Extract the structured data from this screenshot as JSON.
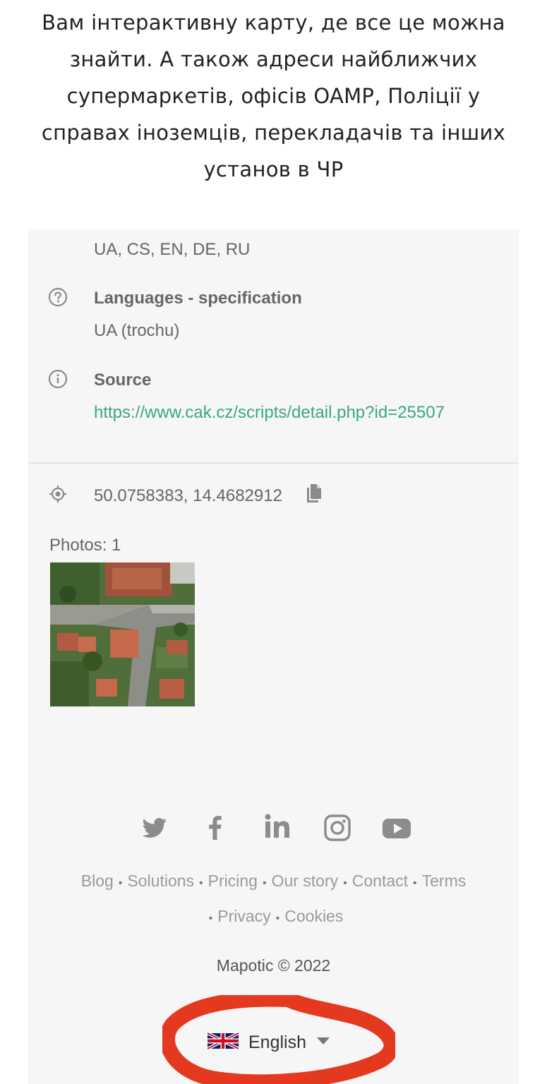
{
  "intro_text": "Вам інтерактивну карту, де все це можна знайти. А також адреси найближчих супермаркетів, офісів OAMP, Поліції у справах іноземців, перекладачів та інших установ в ЧР",
  "details": {
    "languages_value": "UA, CS, EN, DE, RU",
    "lang_spec_label": "Languages - specification",
    "lang_spec_value": "UA (trochu)",
    "source_label": "Source",
    "source_url": "https://www.cak.cz/scripts/detail.php?id=25507"
  },
  "location": {
    "coordinates": "50.0758383, 14.4682912"
  },
  "photos": {
    "label": "Photos: 1"
  },
  "social": [
    "twitter-icon",
    "facebook-icon",
    "linkedin-icon",
    "instagram-icon",
    "youtube-icon"
  ],
  "footer": {
    "links": [
      "Blog",
      "Solutions",
      "Pricing",
      "Our story",
      "Contact",
      "Terms",
      "Privacy",
      "Cookies"
    ],
    "copyright": "Mapotic © 2022"
  },
  "language_selector": {
    "label": "English",
    "flag": "uk-flag-icon"
  },
  "colors": {
    "link": "#3aa880",
    "panel": "#f6f6f6",
    "annotation": "#e5391f"
  }
}
